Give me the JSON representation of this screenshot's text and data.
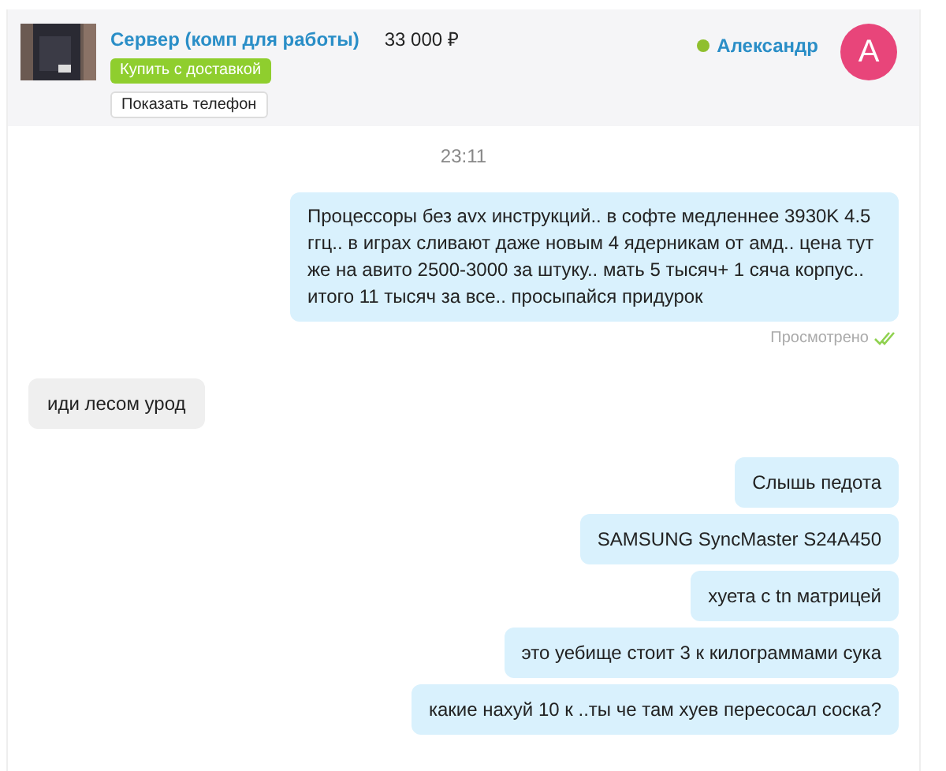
{
  "listing": {
    "title": "Сервер (комп для работы)",
    "price": "33 000 ₽",
    "buy_button": "Купить с доставкой",
    "phone_button": "Показать телефон"
  },
  "seller": {
    "name": "Александр",
    "online": true,
    "avatar_letter": "А"
  },
  "messages": [
    {
      "kind": "time",
      "text": "23:11"
    },
    {
      "kind": "outgoing",
      "text": "Процессоры без avx инструкций.. в софте медленнее 3930K 4.5 ггц.. в играх сливают даже новым 4 ядерникам от амд.. цена тут же на авито 2500-3000 за штуку.. мать 5 тысяч+ 1 сяча корпус.. итого 11 тысяч за все.. просыпайся придурок",
      "status": "Просмотрено",
      "read": true
    },
    {
      "kind": "incoming",
      "text": "иди лесом урод"
    },
    {
      "kind": "outgoing",
      "text": "Слышь педота"
    },
    {
      "kind": "outgoing",
      "text": "SAMSUNG SyncMaster S24A450"
    },
    {
      "kind": "outgoing",
      "text": "хуета с tn матрицей"
    },
    {
      "kind": "outgoing",
      "text": "это уебище стоит 3 к килограммами сука"
    },
    {
      "kind": "outgoing",
      "text": "какие нахуй 10 к ..ты че там хуев пересосал соска?"
    }
  ]
}
